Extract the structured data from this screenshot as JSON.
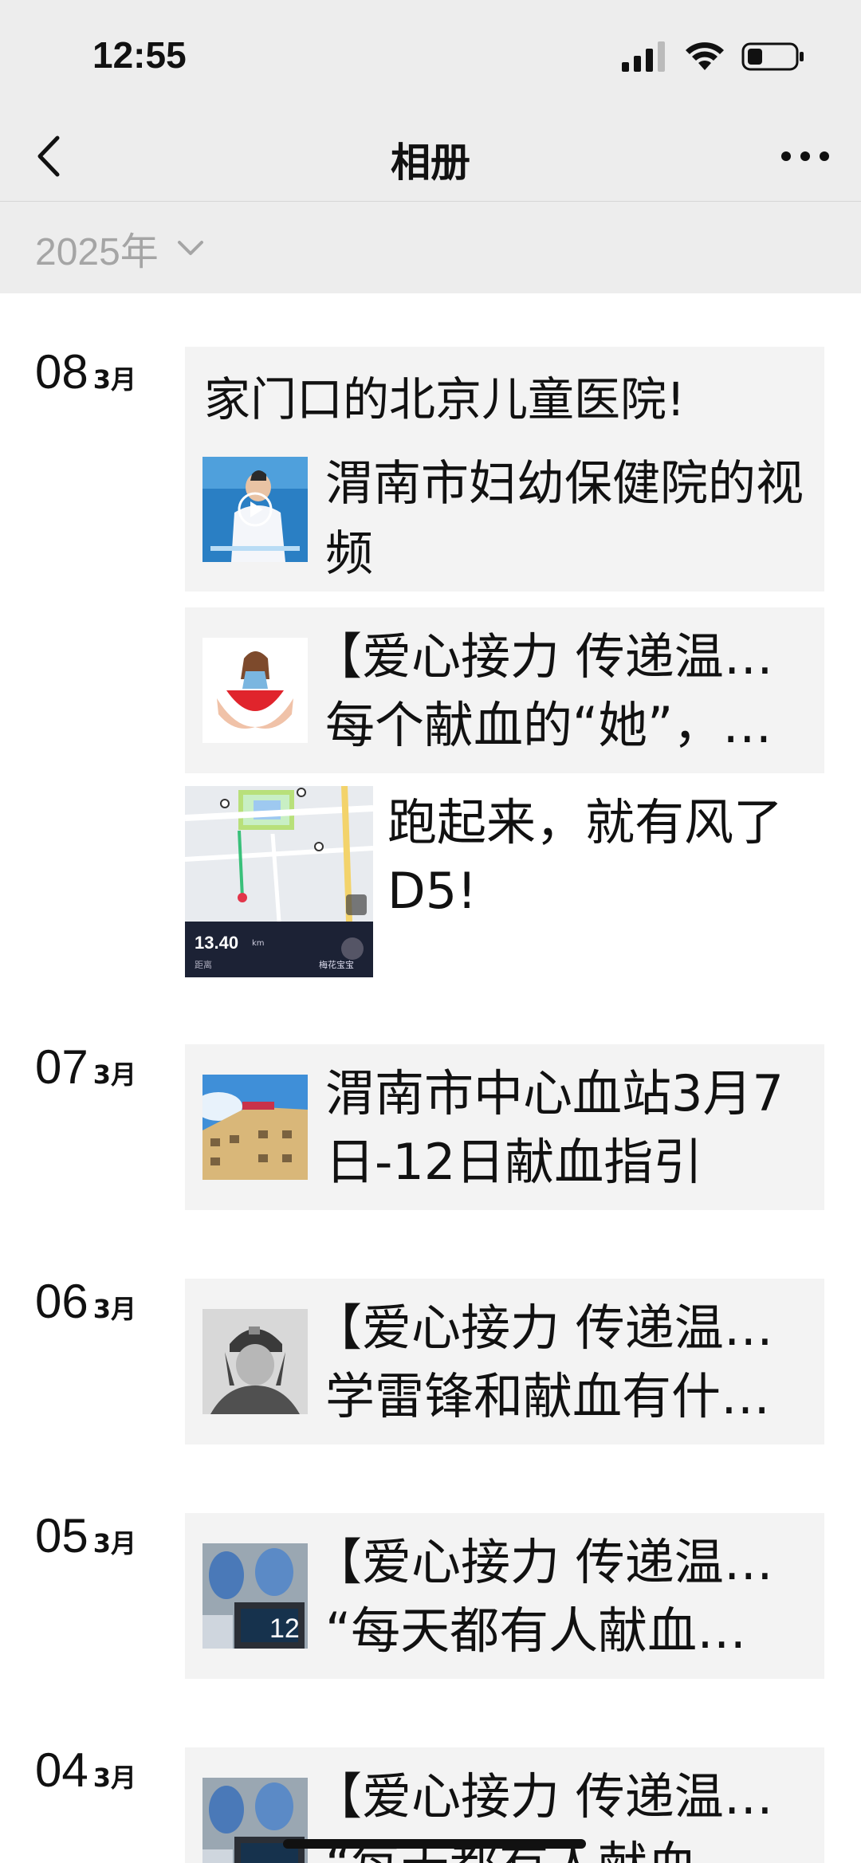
{
  "status_bar": {
    "time": "12:55",
    "icons": [
      "signal-icon",
      "wifi-icon",
      "battery-icon"
    ]
  },
  "nav": {
    "title": "相册",
    "back_icon": "back-chevron-icon",
    "more_icon": "more-icon"
  },
  "filter": {
    "year": "2025年",
    "icon": "chevron-down-icon"
  },
  "days": [
    {
      "day": "08",
      "month": "3月",
      "posts": [
        {
          "text": "家门口的北京儿童医院!"
        },
        {
          "thumb": "doctor-video-thumbnail",
          "text": "渭南市妇幼保健院的视频"
        },
        {
          "thumb": "heart-hands-thumbnail",
          "text_line1": "【爱心接力 传递温暖】",
          "text_line2": "每个献血的“她”，…"
        },
        {
          "thumb": "running-map-thumbnail",
          "text_line1": "跑起来，就有风了",
          "text_line2": "D5!",
          "map": {
            "distance": "13.40",
            "unit": "km",
            "distance_label": "距离",
            "user": "梅花宝宝"
          }
        }
      ]
    },
    {
      "day": "07",
      "month": "3月",
      "posts": [
        {
          "thumb": "blood-station-building-thumbnail",
          "text_line1": "渭南市中心血站3月7",
          "text_line2": "日-12日献血指引"
        }
      ]
    },
    {
      "day": "06",
      "month": "3月",
      "posts": [
        {
          "thumb": "lei-feng-portrait-thumbnail",
          "text_line1": "【爱心接力 传递温暖】",
          "text_line2": "学雷锋和献血有什…"
        }
      ]
    },
    {
      "day": "05",
      "month": "3月",
      "posts": [
        {
          "thumb": "blood-donation-room-thumbnail",
          "text_line1": "【爱心接力 传递温暖】",
          "text_line2": "“每天都有人献血…"
        }
      ]
    },
    {
      "day": "04",
      "month": "3月",
      "posts": [
        {
          "thumb": "blood-donation-room-thumbnail",
          "text_line1": "【爱心接力 传递温暖】",
          "text_line2": "“每天都有人献血…"
        }
      ]
    }
  ],
  "colors": {
    "header_bg": "#ededed",
    "card_bg": "#f3f3f3",
    "year_text": "#a5a5a5",
    "text": "#111111"
  }
}
